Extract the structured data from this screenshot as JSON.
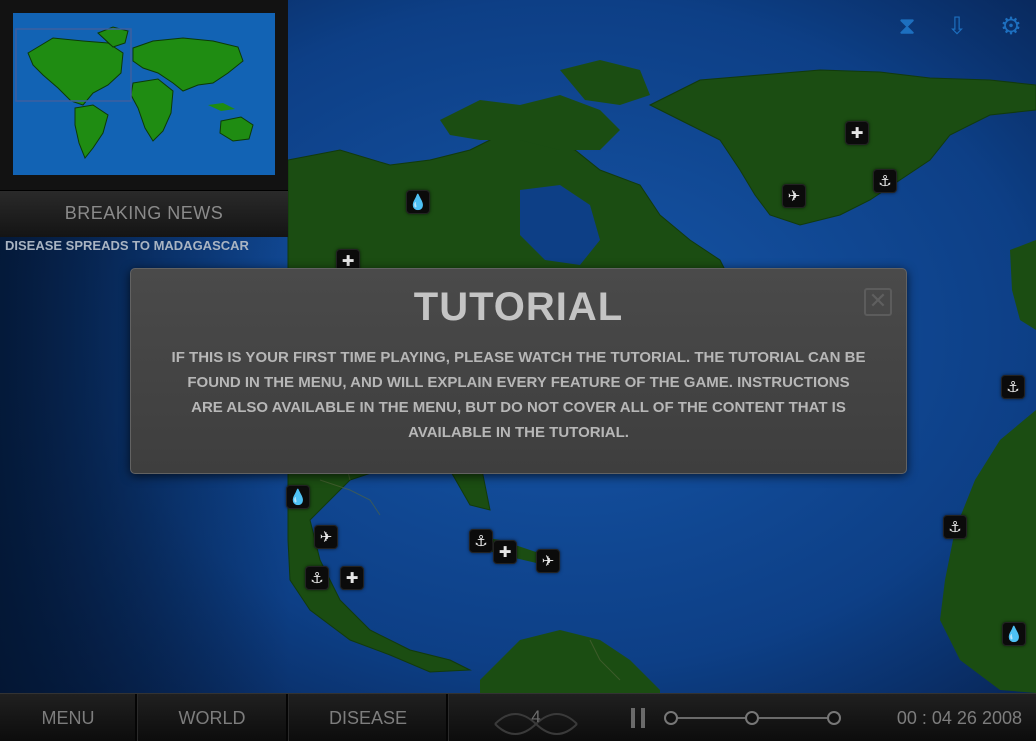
{
  "top_icons": [
    {
      "name": "hourglass-icon",
      "glyph": "⧗"
    },
    {
      "name": "download-arrow-icon",
      "glyph": "⇩"
    },
    {
      "name": "gear-icon",
      "glyph": "⚙"
    }
  ],
  "breaking_news": {
    "title": "BREAKING NEWS",
    "ticker": "DISEASE SPREADS TO MADAGASCAR"
  },
  "dialog": {
    "title": "TUTORIAL",
    "body": "IF THIS IS YOUR FIRST TIME PLAYING, PLEASE WATCH THE TUTORIAL. THE TUTORIAL CAN BE FOUND IN THE MENU, AND WILL EXPLAIN EVERY FEATURE OF THE GAME. INSTRUCTIONS ARE ALSO AVAILABLE IN THE MENU, BUT DO NOT COVER ALL OF THE CONTENT THAT IS AVAILABLE IN THE TUTORIAL.",
    "close_glyph": "✕"
  },
  "bottom_bar": {
    "menu": "MENU",
    "world": "WORLD",
    "disease": "DISEASE",
    "count": "4",
    "date": "00 : 04 26 2008",
    "speed_level": 1
  },
  "map_markers": [
    {
      "type": "hospital-icon",
      "glyph": "✚"
    },
    {
      "type": "port-icon",
      "glyph": "⚓"
    },
    {
      "type": "airport-icon",
      "glyph": "✈"
    },
    {
      "type": "water-icon",
      "glyph": "💧"
    }
  ],
  "colors": {
    "ocean": "#0d3f86",
    "land": "#1b4d12",
    "minimap_ocean": "#1263b4",
    "minimap_land": "#1f8c12",
    "accent_blue": "#1d6fbf"
  }
}
